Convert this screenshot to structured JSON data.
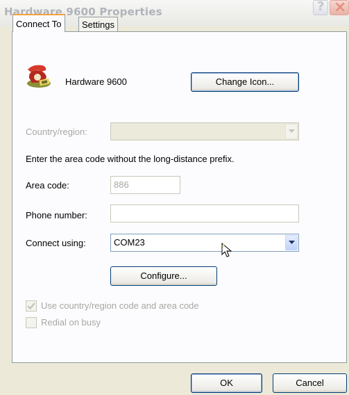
{
  "window": {
    "title": "Hardware 9600 Properties",
    "help_glyph": "?",
    "close_glyph": "×"
  },
  "tabs": [
    {
      "label": "Connect To",
      "active": true
    },
    {
      "label": "Settings",
      "active": false
    }
  ],
  "connection": {
    "name": "Hardware 9600",
    "icon": "phone-icon",
    "change_icon_label": "Change Icon..."
  },
  "country": {
    "label": "Country/region:",
    "value": ""
  },
  "instruction": "Enter the area code without the long-distance prefix.",
  "area_code": {
    "label": "Area code:",
    "value": "886"
  },
  "phone": {
    "label": "Phone number:",
    "value": ""
  },
  "connect_using": {
    "label": "Connect using:",
    "value": "COM23"
  },
  "configure_label": "Configure...",
  "options": {
    "use_country": {
      "label": "Use country/region code and area code",
      "checked": true
    },
    "redial": {
      "label": "Redial on busy",
      "checked": false
    }
  },
  "footer": {
    "ok_label": "OK",
    "cancel_label": "Cancel"
  }
}
